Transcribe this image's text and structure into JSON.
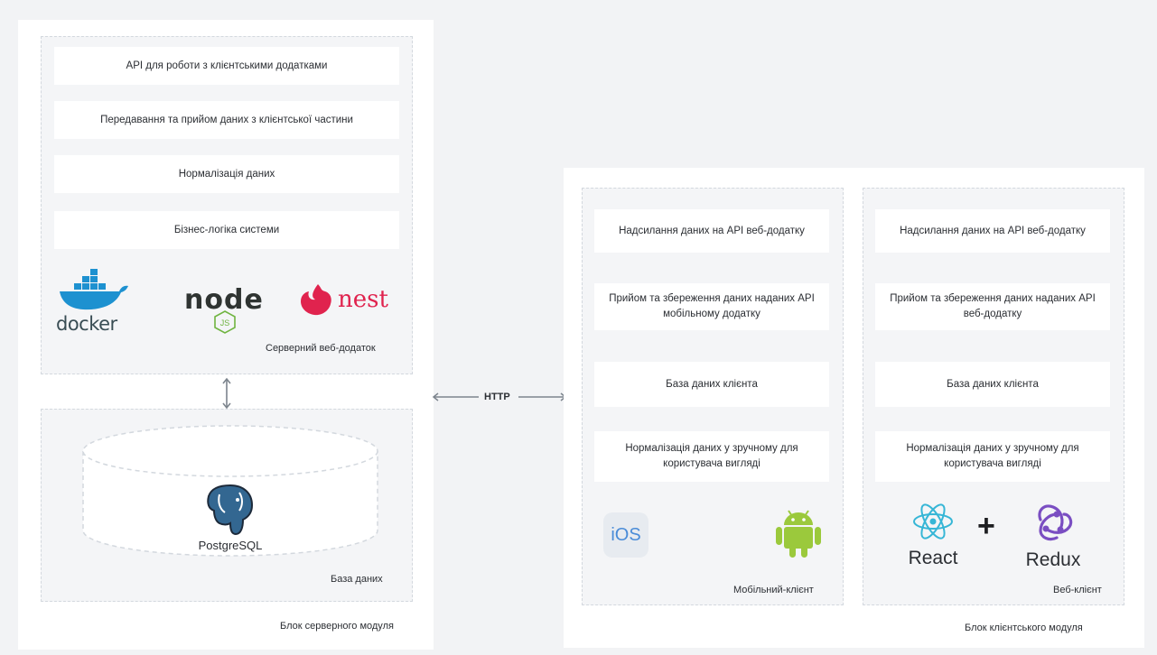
{
  "server_module": {
    "title": "Блок серверного модуля",
    "web_app": {
      "title": "Серверний веб-додаток",
      "cards": [
        "API для роботи з клієнтськими додатками",
        "Передавання та прийом даних з клієнтської частини",
        "Нормалізація даних",
        "Бізнес-логіка системи"
      ],
      "logos": {
        "docker": "docker",
        "node": "node",
        "node_js": "JS",
        "nest": "nest"
      }
    },
    "database": {
      "title": "База даних",
      "logo_text": "PostgreSQL"
    }
  },
  "connection": {
    "label": "HTTP"
  },
  "client_module": {
    "title": "Блок клієнтського модуля",
    "mobile": {
      "title": "Мобільний-клієнт",
      "cards": [
        "Надсилання даних на API веб-додатку",
        "Прийом та збереження даних наданих API мобільному додатку",
        "База даних клієнта",
        "Нормалізація даних у зручному для користувача вигляді"
      ],
      "logos": {
        "ios": "iOS",
        "android": "android-icon"
      }
    },
    "web": {
      "title": "Веб-клієнт",
      "cards": [
        "Надсилання даних на API веб-додатку",
        "Прийом та збереження даних наданих API веб-додатку",
        "База даних клієнта",
        "Нормалізація даних у зручному для користувача вигляді"
      ],
      "logos": {
        "react": "React",
        "plus": "+",
        "redux": "Redux"
      }
    }
  },
  "colors": {
    "docker": "#1d91d0",
    "node": "#2f3432",
    "node_green": "#6fb440",
    "nest": "#e0234e",
    "postgres": "#336791",
    "android": "#9bc93c",
    "react": "#36b6d6",
    "redux": "#7a4ec2"
  }
}
